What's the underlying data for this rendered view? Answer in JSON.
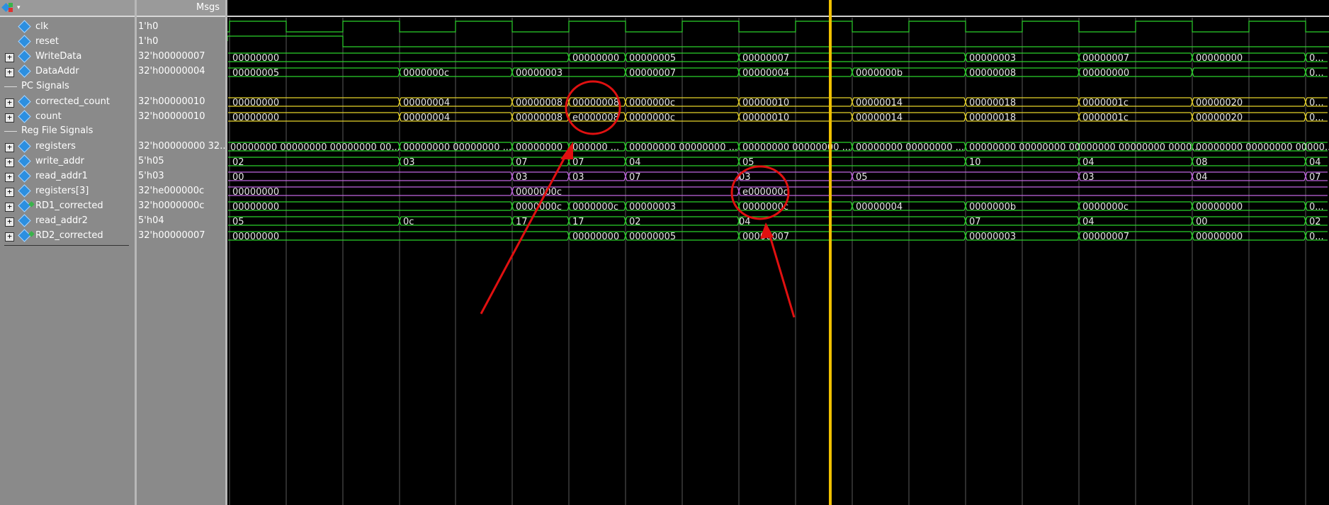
{
  "header": {
    "msgs_label": "Msgs"
  },
  "signals": [
    {
      "name": "clk",
      "value": "1'h0",
      "expandable": false,
      "icon": "signal-diamond-icon"
    },
    {
      "name": "reset",
      "value": "1'h0",
      "expandable": false,
      "icon": "signal-diamond-icon"
    },
    {
      "name": "WriteData",
      "value": "32'h00000007",
      "expandable": true,
      "icon": "signal-diamond-icon"
    },
    {
      "name": "DataAddr",
      "value": "32'h00000004",
      "expandable": true,
      "icon": "signal-diamond-icon"
    },
    {
      "group": "PC Signals"
    },
    {
      "name": "corrected_count",
      "value": "32'h00000010",
      "expandable": true,
      "icon": "signal-diamond-icon"
    },
    {
      "name": "count",
      "value": "32'h00000010",
      "expandable": true,
      "icon": "signal-diamond-icon"
    },
    {
      "group": "Reg File Signals"
    },
    {
      "name": "registers",
      "value": "32'h00000000 32...",
      "expandable": true,
      "icon": "signal-diamond-icon"
    },
    {
      "name": "write_addr",
      "value": "5'h05",
      "expandable": true,
      "icon": "signal-diamond-icon"
    },
    {
      "name": "read_addr1",
      "value": "5'h03",
      "expandable": true,
      "icon": "signal-diamond-icon"
    },
    {
      "name": "registers[3]",
      "value": "32'he000000c",
      "expandable": true,
      "icon": "signal-diamond-icon"
    },
    {
      "name": "RD1_corrected",
      "value": "32'h0000000c",
      "expandable": true,
      "icon": "signal-dual-icon"
    },
    {
      "name": "read_addr2",
      "value": "5'h04",
      "expandable": true,
      "icon": "signal-diamond-icon"
    },
    {
      "name": "RD2_corrected",
      "value": "32'h00000007",
      "expandable": true,
      "icon": "signal-dual-icon"
    }
  ],
  "wave_labels": {
    "WriteData": [
      "00000000",
      "00000000",
      "00000005",
      "00000007",
      "00000003",
      "00000007",
      "00000000",
      "0..."
    ],
    "DataAddr": [
      "00000005",
      "0000000c",
      "00000003",
      "00000007",
      "00000004",
      "0000000b",
      "00000008",
      "00000000",
      "0..."
    ],
    "corrected_count": [
      "00000000",
      "00000004",
      "00000008",
      "00000008",
      "0000000c",
      "00000010",
      "00000014",
      "00000018",
      "0000001c",
      "00000020",
      "0..."
    ],
    "count": [
      "00000000",
      "00000004",
      "00000008",
      "e0000008",
      "0000000c",
      "00000010",
      "00000014",
      "00000018",
      "0000001c",
      "00000020",
      "0..."
    ],
    "registers": [
      "00000000 00000000 00000000 00...",
      "00000000 00000000 ...",
      "00000000",
      "000000 ...",
      "00000000 00000000 ...",
      "00000000 00000000 ...",
      "00000000 00000000 ...",
      "00000000 00000000 00000000 00000000 0000...",
      "00000000 00000000 00000..."
    ],
    "write_addr": [
      "02",
      "03",
      "07",
      "07",
      "04",
      "05",
      "10",
      "04",
      "08",
      "04"
    ],
    "read_addr1": [
      "00",
      "03",
      "03",
      "07",
      "03",
      "05",
      "03",
      "04",
      "07"
    ],
    "registers_3": [
      "00000000",
      "0000000c",
      "e000000c"
    ],
    "RD1_corrected": [
      "00000000",
      "0000000c",
      "0000000c",
      "00000003",
      "0000000c",
      "00000004",
      "0000000b",
      "0000000c",
      "00000000",
      "0..."
    ],
    "read_addr2": [
      "05",
      "0c",
      "17",
      "17",
      "02",
      "04",
      "07",
      "04",
      "00",
      "02"
    ],
    "RD2_corrected": [
      "00000000",
      "00000000",
      "00000005",
      "00000007",
      "00000003",
      "00000007",
      "00000000",
      "0..."
    ]
  },
  "colors": {
    "clk_wave": "#2bd12b",
    "bus_green": "#2bd12b",
    "bus_yellow": "#e5d22a",
    "bus_purple": "#c065e0",
    "cursor": "#f0c000",
    "annotation": "#e01010",
    "grid": "#5a5a5a"
  }
}
